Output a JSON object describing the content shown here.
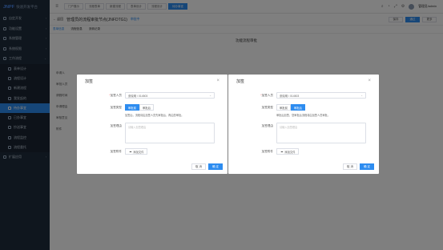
{
  "app": {
    "brand_main": "JNPF",
    "brand_sub": "快速开发平台"
  },
  "sidebar": {
    "items": [
      {
        "label": "自定开发",
        "icon": "grid-icon"
      },
      {
        "label": "功能设置",
        "icon": "grid-icon"
      },
      {
        "label": "系统管理",
        "icon": "gear-icon"
      },
      {
        "label": "系统权限",
        "icon": "shield-icon"
      },
      {
        "label": "工作流程",
        "icon": "flow-icon"
      }
    ],
    "sub_items": [
      {
        "label": "表单设计",
        "active": false
      },
      {
        "label": "流程设计",
        "active": false
      },
      {
        "label": "新建流程",
        "active": false
      },
      {
        "label": "我发起的",
        "active": false
      },
      {
        "label": "待办事宜",
        "active": true
      },
      {
        "label": "已办事宜",
        "active": false
      },
      {
        "label": "抄送事宜",
        "active": false
      },
      {
        "label": "流程监控",
        "active": false
      },
      {
        "label": "流程委托",
        "active": false
      }
    ],
    "bottom_item": {
      "label": "扩展应用"
    }
  },
  "topbar": {
    "tabs": [
      {
        "label": "门户展示",
        "active": false
      },
      {
        "label": "流程表单",
        "active": false
      },
      {
        "label": "新建流程",
        "active": false
      },
      {
        "label": "表单设计",
        "active": false
      },
      {
        "label": "流程设计",
        "active": false
      },
      {
        "label": "待办事宜",
        "active": true
      }
    ],
    "username": "管理员/admin"
  },
  "page": {
    "back_label": "返回",
    "title": "管理员的流程审批节点(JNFDTG1)",
    "badge": "审批中",
    "buttons": {
      "save": "保存",
      "approve": "通过",
      "more": "更多"
    },
    "subtabs": [
      "表单信息",
      "流程信息",
      "流转记录"
    ],
    "section_title": "功能流程审批",
    "bg_fields": [
      "申请人",
      "审批人员",
      "请假时间",
      "申请理由",
      "审核意见",
      "附件"
    ]
  },
  "dialog1": {
    "title": "加签",
    "signer_label": "加签人员",
    "signer_value": "张晓明 / 014503",
    "type_label": "加签类型",
    "options": [
      "审批前",
      "审批后"
    ],
    "selected": 0,
    "hint": "加签后，流程将由加签人员先审批后，再由您审批。",
    "reason_label": "加签理由",
    "reason_placeholder": "请输入加签理由",
    "attach_label": "加签附件",
    "attach_button": "添加文件",
    "cancel": "取 消",
    "confirm": "确 定"
  },
  "dialog2": {
    "title": "加签",
    "signer_label": "加签人员",
    "signer_value": "张晓明 / 014503",
    "type_label": "加签类型",
    "options": [
      "审批前",
      "审批后"
    ],
    "selected": 1,
    "hint": "审批后加签，您审批后流程将由加签人员审批。",
    "reason_label": "加签理由",
    "reason_placeholder": "请输入加签理由",
    "attach_label": "加签附件",
    "attach_button": "添加文件",
    "cancel": "取 消",
    "confirm": "确 定"
  }
}
